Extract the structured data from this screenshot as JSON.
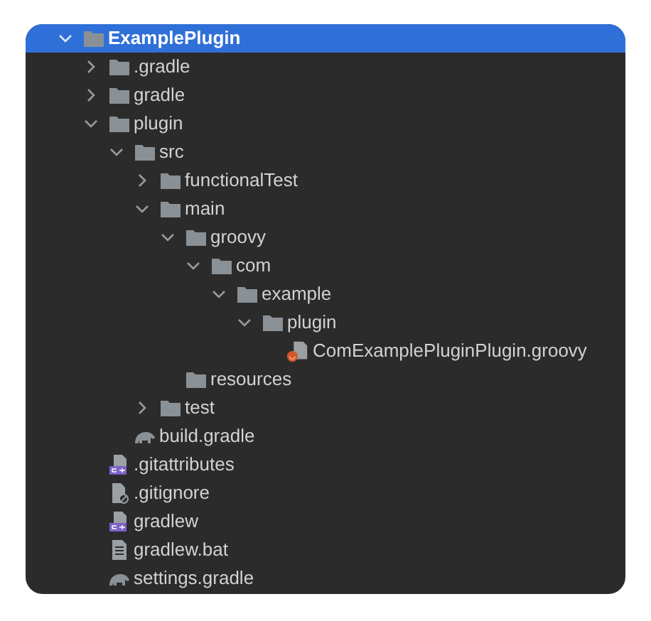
{
  "tree": [
    {
      "name": "ExamplePlugin",
      "kind": "folder",
      "expanded": true,
      "selected": true,
      "children": [
        {
          "name": ".gradle",
          "kind": "folder",
          "expanded": false,
          "selected": false
        },
        {
          "name": "gradle",
          "kind": "folder",
          "expanded": false,
          "selected": false
        },
        {
          "name": "plugin",
          "kind": "folder",
          "expanded": true,
          "selected": false,
          "children": [
            {
              "name": "src",
              "kind": "folder",
              "expanded": true,
              "selected": false,
              "children": [
                {
                  "name": "functionalTest",
                  "kind": "folder",
                  "expanded": false,
                  "selected": false
                },
                {
                  "name": "main",
                  "kind": "folder",
                  "expanded": true,
                  "selected": false,
                  "children": [
                    {
                      "name": "groovy",
                      "kind": "folder",
                      "expanded": true,
                      "selected": false,
                      "children": [
                        {
                          "name": "com",
                          "kind": "folder",
                          "expanded": true,
                          "selected": false,
                          "children": [
                            {
                              "name": "example",
                              "kind": "folder",
                              "expanded": true,
                              "selected": false,
                              "children": [
                                {
                                  "name": "plugin",
                                  "kind": "folder",
                                  "expanded": true,
                                  "selected": false,
                                  "children": [
                                    {
                                      "name": "ComExamplePluginPlugin.groovy",
                                      "kind": "groovy",
                                      "selected": false
                                    }
                                  ]
                                }
                              ]
                            }
                          ]
                        }
                      ]
                    },
                    {
                      "name": "resources",
                      "kind": "folder",
                      "selected": false
                    }
                  ]
                },
                {
                  "name": "test",
                  "kind": "folder",
                  "expanded": false,
                  "selected": false
                }
              ]
            },
            {
              "name": "build.gradle",
              "kind": "gradle",
              "selected": false
            }
          ]
        },
        {
          "name": ".gitattributes",
          "kind": "shell",
          "selected": false
        },
        {
          "name": ".gitignore",
          "kind": "ignore",
          "selected": false
        },
        {
          "name": "gradlew",
          "kind": "shell",
          "selected": false
        },
        {
          "name": "gradlew.bat",
          "kind": "text",
          "selected": false
        },
        {
          "name": "settings.gradle",
          "kind": "gradle",
          "selected": false
        }
      ]
    }
  ]
}
